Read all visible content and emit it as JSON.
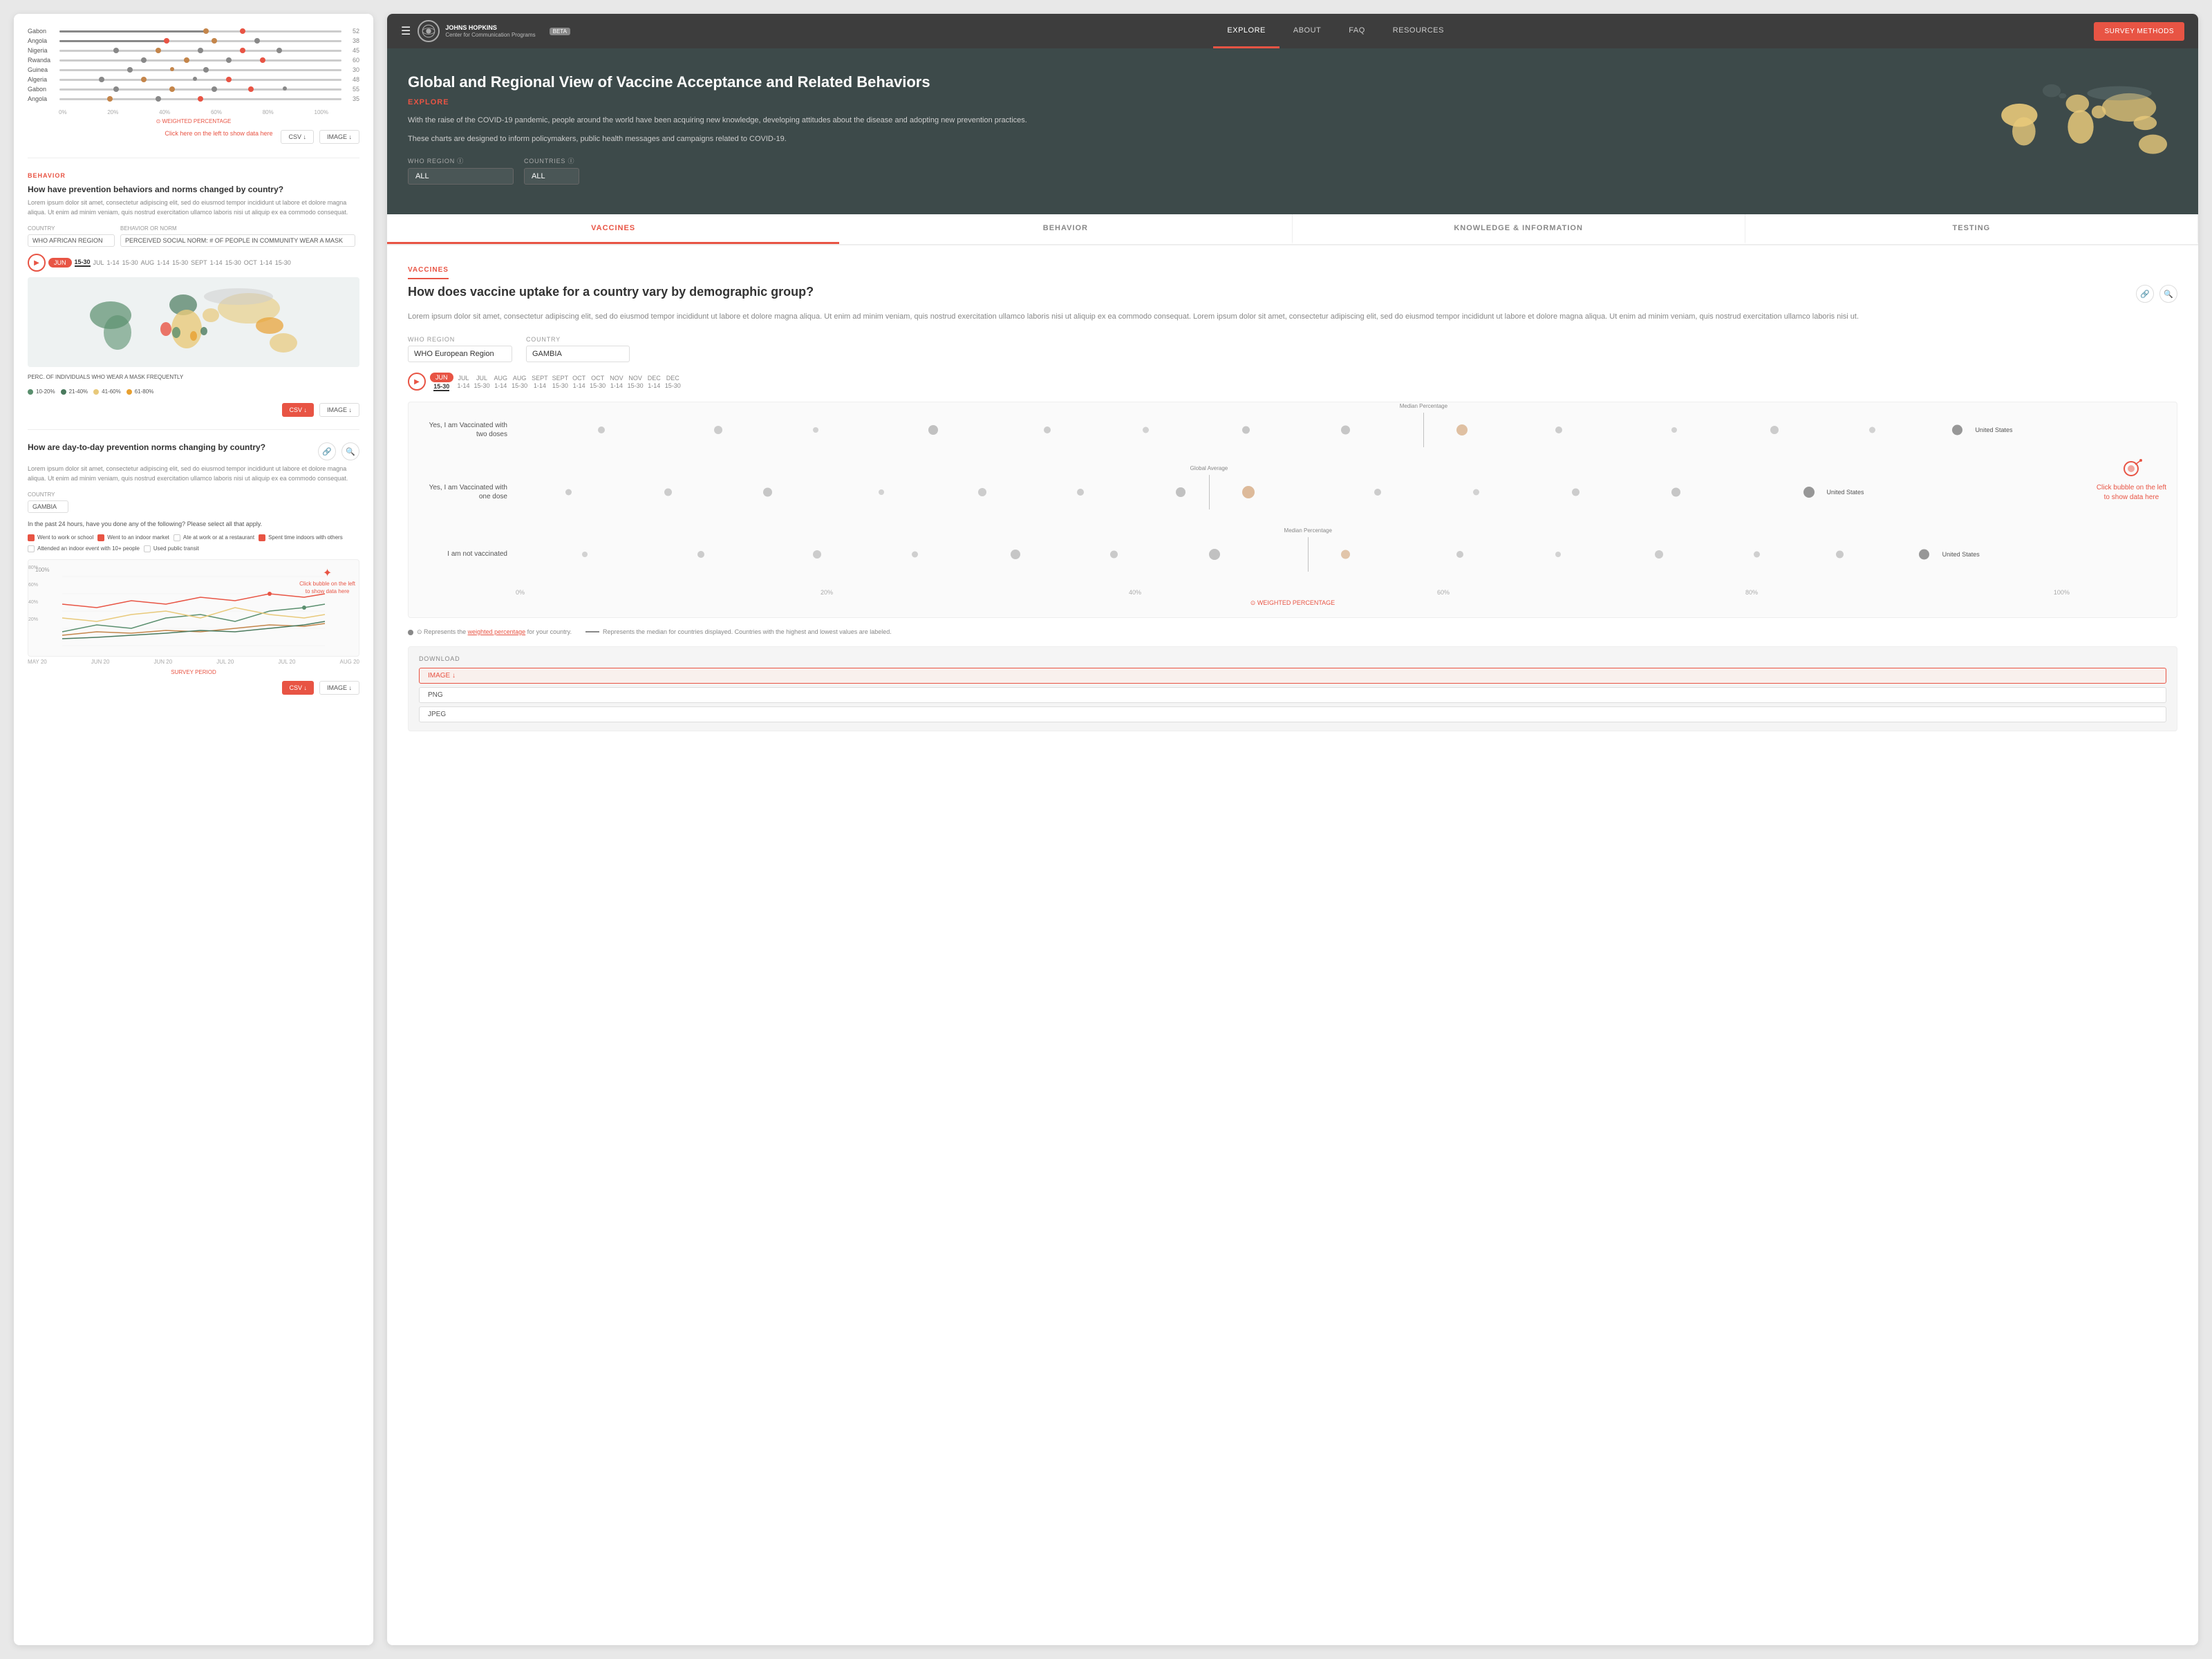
{
  "app": {
    "title": "JOHNS HOPKINS Center for Communication Programs",
    "beta": "BETA"
  },
  "nav": {
    "hamburger": "☰",
    "links": [
      {
        "label": "EXPLORE",
        "active": true
      },
      {
        "label": "ABOUT",
        "active": false
      },
      {
        "label": "FAQ",
        "active": false
      },
      {
        "label": "RESOURCES",
        "active": false
      }
    ],
    "survey_btn": "SURVEY METHODS"
  },
  "hero": {
    "title": "Global and Regional View of Vaccine Acceptance and Related Behaviors",
    "explore_tag": "EXPLORE",
    "description1": "With the raise of the COVID-19 pandemic, people around the world have been acquiring new knowledge, developing attitudes about the disease and adopting new prevention practices.",
    "description2": "These charts are designed to inform policymakers, public health messages and campaigns related to COVID-19.",
    "who_region_label": "WHO REGION",
    "countries_label": "COUNTRIES",
    "who_region_value": "ALL",
    "countries_value": "ALL"
  },
  "tabs": [
    {
      "label": "VACCINES",
      "active": true
    },
    {
      "label": "BEHAVIOR",
      "active": false
    },
    {
      "label": "KNOWLEDGE & INFORMATION",
      "active": false
    },
    {
      "label": "TESTING",
      "active": false
    }
  ],
  "vaccines_section": {
    "tag": "VACCINES",
    "question": "How does vaccine uptake for a country vary by demographic group?",
    "lorem": "Lorem ipsum dolor sit amet, consectetur adipiscing elit, sed do eiusmod tempor incididunt ut labore et dolore magna aliqua. Ut enim ad minim veniam, quis nostrud exercitation ullamco laboris nisi ut aliquip ex ea commodo consequat. Lorem ipsum dolor sit amet, consectetur adipiscing elit, sed do eiusmod tempor incididunt ut labore et dolore magna aliqua. Ut enim ad minim veniam, quis nostrud exercitation ullamco laboris nisi ut.",
    "who_region_label": "WHO REGION",
    "country_label": "COUNTRY",
    "who_region_value": "WHO European Region",
    "country_value": "GAMBIA",
    "play_label": "PLAY",
    "timeline": [
      {
        "label": "JUN",
        "sub": "15-30",
        "active": true,
        "pill": true
      },
      {
        "label": "JUL",
        "sub": "1-14"
      },
      {
        "label": "JUL",
        "sub": "15-30"
      },
      {
        "label": "AUG",
        "sub": "1-14"
      },
      {
        "label": "AUG",
        "sub": "15-30"
      },
      {
        "label": "SEPT",
        "sub": "1-14"
      },
      {
        "label": "SEPT",
        "sub": "15-30"
      },
      {
        "label": "OCT",
        "sub": "1-14"
      },
      {
        "label": "OCT",
        "sub": "15-30"
      },
      {
        "label": "NOV",
        "sub": "1-14"
      },
      {
        "label": "NOV",
        "sub": "15-30"
      },
      {
        "label": "DEC",
        "sub": "1-14"
      },
      {
        "label": "DEC",
        "sub": "15-30"
      }
    ],
    "chart_rows": [
      {
        "label": "Yes, I am Vaccinated with two doses",
        "us_label": "United States",
        "median_label": "Median Percentage"
      },
      {
        "label": "Yes, I am Vaccinated with one dose",
        "us_label": "United States",
        "global_avg": "Global Average"
      },
      {
        "label": "I am not vaccinated",
        "us_label": "United States",
        "median_label": "Median Percentage"
      }
    ],
    "x_axis": [
      "0%",
      "20%",
      "40%",
      "60%",
      "80%",
      "100%"
    ],
    "weighted_label": "⊙ WEIGHTED PERCENTAGE",
    "click_bubble_text": "Click bubble on the left to show data here",
    "legend_text1": "⊙ Represents the weighted percentage for your country.",
    "legend_text2": "Represents the median for countries displayed. Countries with the highest and lowest values are labeled."
  },
  "download": {
    "title": "DOWNLOAD",
    "image_btn": "IMAGE ↓",
    "png_btn": "PNG",
    "jpeg_btn": "JPEG"
  },
  "left_panel": {
    "top_countries": [
      "Gabon",
      "Angola",
      "Nigeria",
      "Rwanda",
      "Guinea",
      "Algeria",
      "Gabon",
      "Angola"
    ],
    "top_pcts": [
      52,
      38,
      45,
      60,
      30,
      48,
      55,
      35
    ],
    "behavior_tag": "BEHAVIOR",
    "behavior_q1": "How have prevention behaviors and norms changed by country?",
    "lorem1": "Lorem ipsum dolor sit amet, consectetur adipiscing elit, sed do eiusmod tempor incididunt ut labore et dolore magna aliqua. Ut enim ad minim veniam, quis nostrud exercitation ullamco laboris nisi ut aliquip ex ea commodo consequat. Lorem ipsum dolor sit amet, consectetur adipiscing elit, sed do eiusmod tempor incididunt ut labore et dolore magna aliqua. Ut enim ad minim veniam, quis nostrud exercitation ullamco laboris nisi ut.",
    "country_label": "COUNTRY",
    "behavior_label": "BEHAVIOR OR NORM",
    "country_value": "WHO AFRICAN REGION",
    "behavior_value": "PERCEIVED SOCIAL NORM: # OF PEOPLE IN COMMUNITY WEAR A MASK",
    "map_legend": [
      {
        "color": "#5a8f6e",
        "label": "10-20%"
      },
      {
        "color": "#4a7a5e",
        "label": "21-40%"
      },
      {
        "color": "#e8c97a",
        "label": "41-60%"
      },
      {
        "color": "#e8a030",
        "label": "61-80%"
      }
    ],
    "behavior_q2": "How are day-to-day prevention norms changing by country?",
    "lorem2": "Lorem ipsum dolor sit amet, consectetur adipiscing elit, sed do eiusmod tempor incididunt ut labore et dolore magna aliqua. Ut enim ad minim veniam, quis nostrud exercitation ullamco laboris nisi ut aliquip ex ea commodo consequat. Lorem ipsum dolor sit amet, consectetur adipiscing elit, sed do eiusmod tempor incididunt ut labore et dolore magna aliqua. Ut enim ad minim veniam, quis nostrud exercitation ullamco laboris nisi ut.",
    "country_value2": "GAMBIA",
    "activities_q": "In the past 24 hours, have you done any of the following? Please select all that apply.",
    "activities": [
      {
        "label": "Went to work or school",
        "checked": true
      },
      {
        "label": "Went to an indoor market",
        "checked": true
      },
      {
        "label": "Ate at work or at a restaurant",
        "checked": false
      },
      {
        "label": "Spent time indoors with others",
        "checked": true
      },
      {
        "label": "Attended an indoor event with 10+ people",
        "checked": false
      },
      {
        "label": "Used public transit",
        "checked": false
      }
    ],
    "survey_label": "SURVEY PERIOD",
    "x_axis_labels": [
      "MAY 20",
      "JUN 20",
      "JUN 20",
      "JUL 20",
      "JUL 20",
      "AUG 20"
    ]
  }
}
